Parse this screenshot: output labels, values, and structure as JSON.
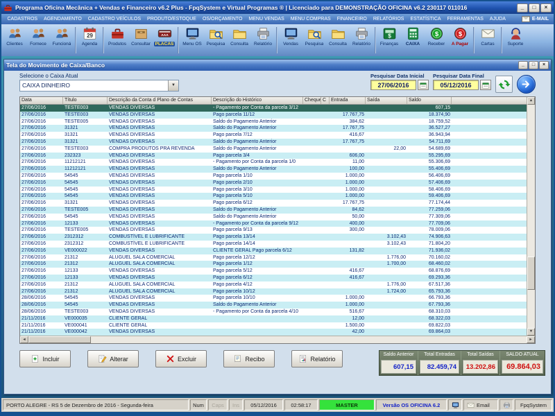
{
  "window": {
    "title": "Programa Oficina Mecânica + Vendas e Financeiro v6.2 Plus - FpqSystem e Virtual Programas ® | Licenciado para  DEMONSTRAÇÃO OFICINA v6.2 230117 011016"
  },
  "menu": {
    "items": [
      "CADASTROS",
      "AGENDAMENTO",
      "CADASTRO VEÍCULOS",
      "PRODUTO/ESTOQUE",
      "OS/ORÇAMENTO",
      "MENU VENDAS",
      "MENU COMPRAS",
      "FINANCEIRO",
      "RELATÓRIOS",
      "ESTATÍSTICA",
      "FERRAMENTAS",
      "AJUDA"
    ],
    "email": "E-MAIL"
  },
  "toolbar": {
    "items": [
      {
        "label": "Clientes",
        "icon": "users"
      },
      {
        "label": "Fornece",
        "icon": "users"
      },
      {
        "label": "Funcioná",
        "icon": "users",
        "sep": true
      },
      {
        "label": "Agenda",
        "icon": "calendar",
        "sep": true
      },
      {
        "label": "Produtos",
        "icon": "toolbox"
      },
      {
        "label": "Consultar",
        "icon": "archive"
      },
      {
        "label": "PLACAS",
        "icon": "plate",
        "style": "badge",
        "sep": true
      },
      {
        "label": "Menu OS",
        "icon": "monitor"
      },
      {
        "label": "Pesquisa",
        "icon": "folder-search"
      },
      {
        "label": "Consulta",
        "icon": "folder"
      },
      {
        "label": "Relatório",
        "icon": "printer",
        "sep": true
      },
      {
        "label": "Vendas",
        "icon": "monitor"
      },
      {
        "label": "Pesquisa",
        "icon": "folder-search"
      },
      {
        "label": "Consulta",
        "icon": "folder"
      },
      {
        "label": "Relatório",
        "icon": "printer",
        "sep": true
      },
      {
        "label": "Finanças",
        "icon": "money"
      },
      {
        "label": "CAIXA",
        "icon": "calculator",
        "style": "caps"
      },
      {
        "label": "Receber",
        "icon": "coin-green"
      },
      {
        "label": "A Pagar",
        "icon": "coin-red",
        "style": "red",
        "sep": true
      },
      {
        "label": "Cartas",
        "icon": "mail",
        "sep": true
      },
      {
        "label": "Suporte",
        "icon": "headset"
      }
    ]
  },
  "panel": {
    "title": "Tela do Movimento de Caixa/Banco",
    "caixa_label": "Selecione o Caixa Atual",
    "caixa_value": "CAIXA DINHEIRO",
    "date_initial_label": "Pesquisar Data Inicial",
    "date_initial": "27/06/2016",
    "date_final_label": "Pesquisar Data Final",
    "date_final": "05/12/2016"
  },
  "table": {
    "columns": [
      "Data",
      "Título",
      "Descrição da Conta d Plano de Contas",
      "Descrição do Histórico",
      "Cheque",
      "C",
      "Entrada",
      "Saída",
      "Saldo"
    ],
    "selected_row_index": 0,
    "rows": [
      [
        "27/06/2016",
        "TESTE003",
        "VENDAS DIVERSAS",
        "- Pagamento por Conta da parcela 3/12",
        "",
        "",
        "",
        "",
        "607,15"
      ],
      [
        "27/06/2016",
        "TESTE003",
        "VENDAS DIVERSAS",
        "Pago parcela 11/12",
        "",
        "",
        "17.767,75",
        "",
        "18.374,90"
      ],
      [
        "27/06/2016",
        "TESTE005",
        "VENDAS DIVERSAS",
        "Saldo do Pagamento Anterior",
        "",
        "",
        "384,62",
        "",
        "18.759,52"
      ],
      [
        "27/06/2016",
        "31321",
        "VENDAS DIVERSAS",
        "Saldo do Pagamento Anterior",
        "",
        "",
        "17.767,75",
        "",
        "36.527,27"
      ],
      [
        "27/06/2016",
        "31321",
        "VENDAS DIVERSAS",
        "Pago parcela 7/12",
        "",
        "",
        "416,67",
        "",
        "36.943,94"
      ],
      [
        "27/06/2016",
        "31321",
        "VENDAS DIVERSAS",
        "Saldo do Pagamento Anterior",
        "",
        "",
        "17.767,75",
        "",
        "54.711,69"
      ],
      [
        "27/06/2016",
        "TESTE003",
        "COMPRA PRODUTOS PRA REVENDA",
        "Saldo do Pagamento Anterior",
        "",
        "",
        "",
        "22,00",
        "54.689,69"
      ],
      [
        "27/06/2016",
        "232323",
        "VENDAS DIVERSAS",
        "Pago parcela 3/4",
        "",
        "",
        "606,00",
        "",
        "55.295,69"
      ],
      [
        "27/06/2016",
        "11212121",
        "VENDAS DIVERSAS",
        "- Pagamento por Conta da parcela 1/0",
        "",
        "",
        "11,00",
        "",
        "55.306,69"
      ],
      [
        "27/06/2016",
        "11212121",
        "VENDAS DIVERSAS",
        "Saldo do Pagamento Anterior",
        "",
        "",
        "100,00",
        "",
        "55.406,69"
      ],
      [
        "27/06/2016",
        "54545",
        "VENDAS DIVERSAS",
        "Pago parcela 1/10",
        "",
        "",
        "1.000,00",
        "",
        "56.406,69"
      ],
      [
        "27/06/2016",
        "54545",
        "VENDAS DIVERSAS",
        "Pago parcela 2/10",
        "",
        "",
        "1.000,00",
        "",
        "57.406,69"
      ],
      [
        "27/06/2016",
        "54545",
        "VENDAS DIVERSAS",
        "Pago parcela 3/10",
        "",
        "",
        "1.000,00",
        "",
        "58.406,69"
      ],
      [
        "27/06/2016",
        "54545",
        "VENDAS DIVERSAS",
        "Pago parcela 5/10",
        "",
        "",
        "1.000,00",
        "",
        "59.406,69"
      ],
      [
        "27/06/2016",
        "31321",
        "VENDAS DIVERSAS",
        "Pago parcela 6/12",
        "",
        "",
        "17.767,75",
        "",
        "77.174,44"
      ],
      [
        "27/06/2016",
        "TESTE005",
        "VENDAS DIVERSAS",
        "Saldo do Pagamento Anterior",
        "",
        "",
        "84,62",
        "",
        "77.259,06"
      ],
      [
        "27/06/2016",
        "54545",
        "VENDAS DIVERSAS",
        "Saldo do Pagamento Anterior",
        "",
        "",
        "50,00",
        "",
        "77.309,06"
      ],
      [
        "27/06/2016",
        "12133",
        "VENDAS DIVERSAS",
        "- Pagamento por Conta da parcela 9/12",
        "",
        "",
        "400,00",
        "",
        "77.709,06"
      ],
      [
        "27/06/2016",
        "TESTE005",
        "VENDAS DIVERSAS",
        "Pago parcela 9/13",
        "",
        "",
        "300,00",
        "",
        "78.009,06"
      ],
      [
        "27/06/2016",
        "2312312",
        "COMBUSTÍVEL E LUBRIFICANTE",
        "Pago parcela 13/14",
        "",
        "",
        "",
        "3.102,43",
        "74.906,63"
      ],
      [
        "27/06/2016",
        "2312312",
        "COMBUSTÍVEL E LUBRIFICANTE",
        "Pago parcela 14/14",
        "",
        "",
        "",
        "3.102,43",
        "71.804,20"
      ],
      [
        "27/06/2016",
        "VE000022",
        "VENDAS DIVERSAS",
        "CLIENTE GERAL Pago parcela 6/12",
        "",
        "",
        "131,82",
        "",
        "71.936,02"
      ],
      [
        "27/06/2016",
        "21312",
        "ALUGUEL SALA COMERCIAL",
        "Pago parcela 12/12",
        "",
        "",
        "",
        "1.776,00",
        "70.160,02"
      ],
      [
        "27/06/2016",
        "21312",
        "ALUGUEL SALA COMERCIAL",
        "Pago parcela 1/12",
        "",
        "",
        "",
        "1.700,00",
        "68.460,02"
      ],
      [
        "27/06/2016",
        "12133",
        "VENDAS DIVERSAS",
        "Pago parcela 5/12",
        "",
        "",
        "416,67",
        "",
        "68.876,69"
      ],
      [
        "27/06/2016",
        "12133",
        "VENDAS DIVERSAS",
        "Pago parcela 6/12",
        "",
        "",
        "416,67",
        "",
        "69.293,36"
      ],
      [
        "27/06/2016",
        "21312",
        "ALUGUEL SALA COMERCIAL",
        "Pago parcela 4/12",
        "",
        "",
        "",
        "1.776,00",
        "67.517,36"
      ],
      [
        "27/06/2016",
        "21312",
        "ALUGUEL SALA COMERCIAL",
        "Pago parcela 10/12",
        "",
        "",
        "",
        "1.724,00",
        "65.793,36"
      ],
      [
        "28/06/2016",
        "54545",
        "VENDAS DIVERSAS",
        "Pago parcela 10/10",
        "",
        "",
        "1.000,00",
        "",
        "66.793,36"
      ],
      [
        "28/06/2016",
        "54545",
        "VENDAS DIVERSAS",
        "Saldo do Pagamento Anterior",
        "",
        "",
        "1.000,00",
        "",
        "67.793,36"
      ],
      [
        "28/06/2016",
        "TESTE003",
        "VENDAS DIVERSAS",
        "- Pagamento por Conta da parcela 4/10",
        "",
        "",
        "516,67",
        "",
        "68.310,03"
      ],
      [
        "21/11/2016",
        "VE000035",
        "CLIENTE GERAL",
        "",
        "",
        "",
        "12,00",
        "",
        "68.322,03"
      ],
      [
        "21/11/2016",
        "VE000041",
        "CLIENTE GERAL",
        "",
        "",
        "",
        "1.500,00",
        "",
        "69.822,03"
      ],
      [
        "21/11/2016",
        "VE000042",
        "VENDAS DIVERSAS",
        "",
        "",
        "",
        "42,00",
        "",
        "69.864,03"
      ]
    ]
  },
  "actions": [
    {
      "label": "Incluir",
      "icon": "add"
    },
    {
      "label": "Alterar",
      "icon": "edit"
    },
    {
      "label": "Excluir",
      "icon": "delete"
    },
    {
      "label": "Recibo",
      "icon": "receipt"
    },
    {
      "label": "Relatório",
      "icon": "report"
    }
  ],
  "summary": {
    "items": [
      {
        "label": "Saldo Anterior",
        "value": "607,15",
        "color": "blue"
      },
      {
        "label": "Total Entradas",
        "value": "82.459,74",
        "color": "blue"
      },
      {
        "label": "Total Saídas",
        "value": "13.202,86",
        "color": "red"
      },
      {
        "label": "SALDO ATUAL",
        "value": "69.864,03",
        "color": "red",
        "big": true
      }
    ]
  },
  "statusbar": {
    "location": "PORTO ALEGRE - RS  5 de Dezembro de 2016 - Segunda-feira",
    "num": "Num",
    "caps": "Caps",
    "ins": "Ins",
    "date": "05/12/2016",
    "time": "02:58:17",
    "user": "MASTER",
    "version": "Versão OS OFICINA 6.2",
    "email": "Email",
    "brand": "FpqSystem"
  },
  "colors": {
    "accent_blue": "#2c5cae",
    "selected_row": "#2f685c",
    "zebra_row": "#c9eef4",
    "date_field_bg": "#ffff9e",
    "master_green": "#35e23c",
    "value_blue": "#1322c8",
    "value_red": "#cf1010"
  }
}
